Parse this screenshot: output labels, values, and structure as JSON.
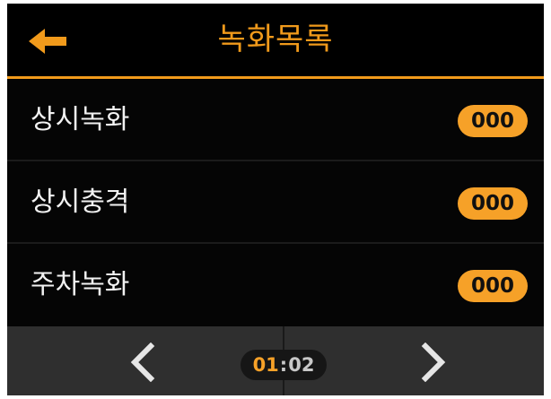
{
  "header": {
    "title": "녹화목록",
    "back_icon": "arrow-left-icon"
  },
  "colors": {
    "accent": "#f19a1b",
    "badge": "#f6a128",
    "background": "#050505",
    "footer": "#2f2f2f"
  },
  "list": {
    "items": [
      {
        "label": "상시녹화",
        "count": "000"
      },
      {
        "label": "상시충격",
        "count": "000"
      },
      {
        "label": "주차녹화",
        "count": "000"
      }
    ]
  },
  "pagination": {
    "prev_icon": "chevron-left-icon",
    "next_icon": "chevron-right-icon",
    "current": "01",
    "separator": ":",
    "total": "02"
  }
}
